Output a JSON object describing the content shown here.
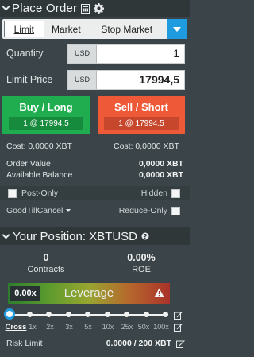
{
  "order": {
    "title": "Place Order",
    "tabs": [
      "Limit",
      "Market",
      "Stop Market"
    ],
    "active_tab": "Limit",
    "quantity_label": "Quantity",
    "quantity_unit": "USD",
    "quantity_value": "1",
    "price_label": "Limit Price",
    "price_unit": "USD",
    "price_value": "17994,5",
    "buy_label": "Buy / Long",
    "buy_sub": "1 @ 17994.5",
    "sell_label": "Sell / Short",
    "sell_sub": "1 @ 17994.5",
    "buy_cost": "Cost: 0,0000 XBT",
    "sell_cost": "Cost: 0,0000 XBT",
    "order_value_label": "Order Value",
    "order_value": "0,0000 XBT",
    "balance_label": "Available Balance",
    "balance_value": "0,0000 XBT",
    "post_only_label": "Post-Only",
    "hidden_label": "Hidden",
    "tif_label": "GoodTillCancel",
    "reduce_only_label": "Reduce-Only"
  },
  "position": {
    "title": "Your Position: XBTUSD",
    "contracts_value": "0",
    "contracts_label": "Contracts",
    "roe_value": "0.00%",
    "roe_label": "ROE",
    "leverage_value": "0.00x",
    "leverage_title": "Leverage",
    "slider_level": 0,
    "ticks": [
      "Cross",
      "1x",
      "2x",
      "3x",
      "5x",
      "10x",
      "25x",
      "50x",
      "100x"
    ],
    "risk_label": "Risk Limit",
    "risk_value": "0.0000 / 200 XBT"
  },
  "colors": {
    "buy": "#1fad4f",
    "sell": "#ee5a38",
    "accent": "#1f9ce0"
  },
  "icons": [
    "chevron-down-icon",
    "calculator-icon",
    "gear-icon",
    "dropdown-icon",
    "help-icon",
    "warning-icon",
    "edit-icon"
  ]
}
